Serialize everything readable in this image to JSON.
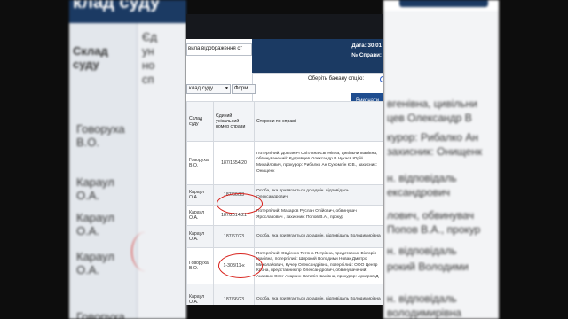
{
  "left_panel": {
    "header": "клад суду",
    "col1_header": "Склад суду",
    "col2_header_lines": [
      "Єд",
      "ун",
      "но",
      "сп"
    ],
    "judges": [
      "Говоруха В.О.",
      "Караул О.А.",
      "Караул О.А.",
      "Караул О.А.",
      "Говоруха"
    ]
  },
  "right_panel": {
    "lines": [
      "вгенівна, цивільни",
      "цев Олександр В",
      "курор: Рибалко Ан",
      "захисник: Онищенк",
      "",
      "н. відповідаль",
      "ександрович",
      "лович, обвинувач",
      "Попов В.А., прокур",
      "",
      "н. відповідаль",
      "имирівна",
      "на, представник",
      "рокий Володими",
      "ександрівна, пр",
      "н. відповідаль",
      "володимирівна"
    ]
  },
  "header": {
    "date": "Дата: 30.01",
    "case_no": "№ Справи:"
  },
  "filter": {
    "text": "вила відображення ст"
  },
  "modal": {
    "prompt": "Оберіть бажану опцію:",
    "option_label": "Р",
    "button": "Виконати"
  },
  "select_bar": {
    "select1": "клад суду",
    "select2": "Форм"
  },
  "table": {
    "headers": [
      "Склад суду",
      "Єдиний унікальний номер справи",
      "Сторони по справі"
    ],
    "rows": [
      {
        "judge": "Говоруха В.О.",
        "case": "187/1654/20",
        "parties": "Потерпілий: Довганич Світлана Євгенівна, цивільни Іванівна, обвинувачений: Кудрявцев Олександр В Чукаєв Юрій Михайлович, прокурор: Рибалко Ан Сухомлін Є.В., захисник: Онищенк"
      },
      {
        "judge": "Караул О.А.",
        "case": "187/66/23",
        "parties": "Особа, яка притягається до адмін. відповідаль Олександрович"
      },
      {
        "judge": "Караул О.А.",
        "case": "187/2014/21",
        "parties": "Потерпілий: Макаров Руслан Олійович, обвинувач Ярославович , захисник: Попов В.А., прокур"
      },
      {
        "judge": "Караул О.А.",
        "case": "187/67/23",
        "parties": "Особа, яка притягається до адмін. відповідаль Володимирівна"
      },
      {
        "judge": "Говоруха В.О.",
        "case": "1-308/11-к",
        "parties": "Потерпілий: Овдієнко Тетяна Петрівна, представник Вікторія Іванівна, потерпілий: Широкий Володими Новак Дмитро Миколайович, Кучер Олександрівна, потерпілий: ООО Центр Крона, представник пр Олександрович, обвинувачений: Акарвин Олег Акаркин Наталія Іванівна, прокурор: Архаров Д"
      },
      {
        "judge": "Караул О.А.",
        "case": "187/66/23",
        "parties": "Особа, яка притягається до адмін. відповідаль Володимирівна"
      }
    ]
  },
  "colors": {
    "navy": "#1b3a63",
    "annotation_red": "#d8211b",
    "button_blue": "#1f4d8f"
  }
}
